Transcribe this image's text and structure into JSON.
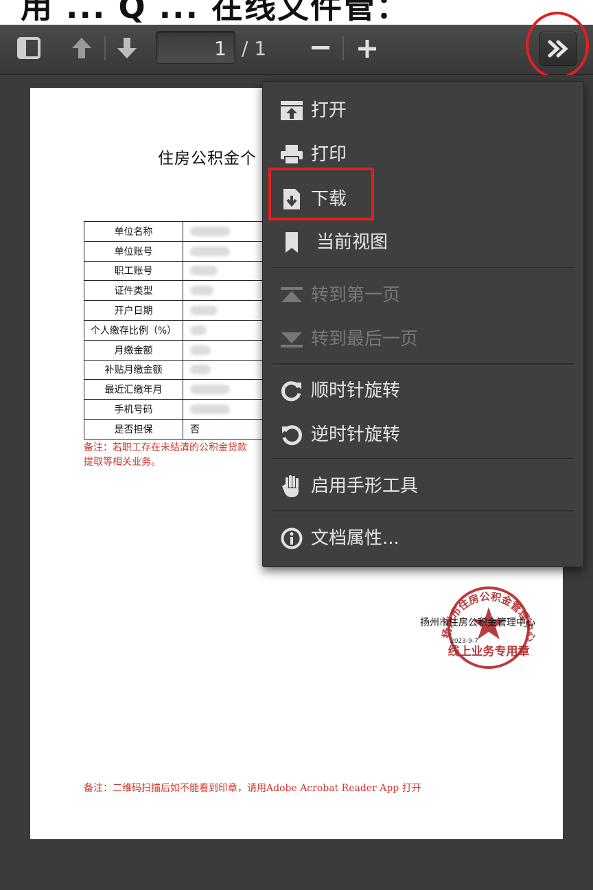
{
  "caption": "用 ... Q ... 在线文件管：",
  "toolbar": {
    "page_current": "1",
    "page_total": "/ 1",
    "zoom_out": "−",
    "zoom_in": "+"
  },
  "document": {
    "title": "住房公积金个",
    "rows": [
      {
        "label": "单位名称",
        "value": ""
      },
      {
        "label": "单位账号",
        "value": ""
      },
      {
        "label": "职工账号",
        "value": ""
      },
      {
        "label": "证件类型",
        "value": ""
      },
      {
        "label": "开户日期",
        "value": ""
      },
      {
        "label": "个人缴存比例（%）",
        "value": ""
      },
      {
        "label": "月缴金额",
        "value": ""
      },
      {
        "label": "补贴月缴金额",
        "value": ""
      },
      {
        "label": "最近汇缴年月",
        "value": ""
      },
      {
        "label": "手机号码",
        "value": ""
      },
      {
        "label": "是否担保",
        "value": "否"
      }
    ],
    "remark_line1": "备注：若职工存在未结清的公积金贷款",
    "remark_line2": "提取等相关业务。",
    "stamp_org": "扬州市住房公积金管理中心",
    "stamp_date": "2023-9-7",
    "stamp_ring_text": "扬州市住房公积金管理中心",
    "stamp_bottom_text": "线上业务专用章",
    "remark_bottom": "备注：二维码扫描后如不能看到印章，请用Adobe Acrobat Reader App 打开"
  },
  "menu": {
    "items": [
      {
        "label": "打开",
        "icon": "open-icon"
      },
      {
        "label": "打印",
        "icon": "print-icon"
      },
      {
        "label": "下载",
        "icon": "download-icon"
      },
      {
        "label": "当前视图",
        "icon": "bookmark-icon"
      },
      {
        "label": "转到第一页",
        "icon": "first-page-icon"
      },
      {
        "label": "转到最后一页",
        "icon": "last-page-icon"
      },
      {
        "label": "顺时针旋转",
        "icon": "rotate-cw-icon"
      },
      {
        "label": "逆时针旋转",
        "icon": "rotate-ccw-icon"
      },
      {
        "label": "启用手形工具",
        "icon": "hand-icon"
      },
      {
        "label": "文档属性...",
        "icon": "info-icon"
      }
    ]
  },
  "colors": {
    "highlight": "#e02020",
    "remark": "#d6342c",
    "stamp": "#b0282a"
  }
}
